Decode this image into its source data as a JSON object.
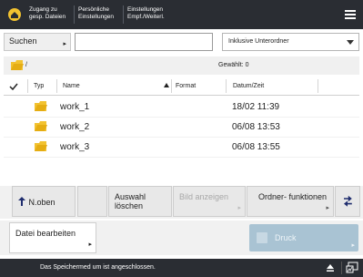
{
  "topbar": {
    "tab1": "Zugang zu gesp. Dateien",
    "tab2": "Persönliche Einstellungen",
    "tab3": "Einstellungen Empf./Weiterl.",
    "icons": {
      "home": "home-icon",
      "menu": "menu-icon"
    }
  },
  "search": {
    "button_label": "Suchen",
    "button_corner": "▸",
    "input_value": "",
    "scope_value": "Inklusive Unterordner"
  },
  "path": {
    "path_text": "/",
    "selected_label": "Gewählt: 0"
  },
  "table": {
    "headers": {
      "type": "Typ",
      "name": "Name",
      "format": "Format",
      "date": "Datum/Zeit"
    },
    "rows": [
      {
        "name": "work_1",
        "date": "18/02 11:39"
      },
      {
        "name": "work_2",
        "date": "06/08 13:53"
      },
      {
        "name": "work_3",
        "date": "06/08 13:55"
      }
    ]
  },
  "toolbar": {
    "up_label": "N.oben",
    "clear_selection_label": "Auswahl löschen",
    "show_image_label": "Bild anzeigen",
    "folder_functions_label": "Ordner- funktionen",
    "corner_marker": "▸"
  },
  "actions": {
    "edit_file_label": "Datei bearbeiten",
    "print_label": "Druck"
  },
  "status": {
    "message": "Das Speichermed um ist angeschlossen."
  },
  "colors": {
    "topbar_bg": "#2a2d33",
    "folder_yellow": "#f2c230",
    "print_disabled": "#a9c3d3"
  }
}
